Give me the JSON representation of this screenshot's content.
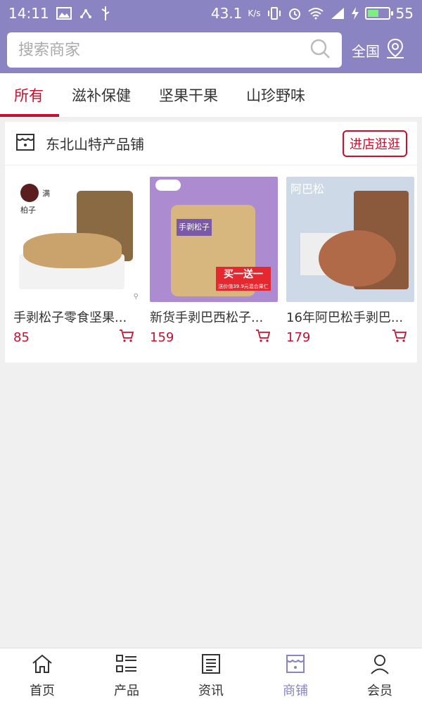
{
  "status_bar": {
    "time": "14:11",
    "speed": "43.1",
    "speed_unit": "K/s",
    "battery": "55",
    "battery_level": 0.55
  },
  "search": {
    "placeholder": "搜索商家",
    "region": "全国"
  },
  "tabs": [
    {
      "label": "所有",
      "active": true
    },
    {
      "label": "滋补保健",
      "active": false
    },
    {
      "label": "坚果干果",
      "active": false
    },
    {
      "label": "山珍野味",
      "active": false
    }
  ],
  "store": {
    "name": "东北山特产品铺",
    "visit_label": "进店逛逛",
    "products": [
      {
        "title": "手剥松子零食坚果...",
        "price": "85",
        "image_label": "满柏子"
      },
      {
        "title": "新货手剥巴西松子...",
        "price": "159",
        "image_label": "手剥松子",
        "promo": "买一送一",
        "promo_sub": "送价值39.9元混合果仁"
      },
      {
        "title": "16年阿巴松手剥巴...",
        "price": "179",
        "image_label": "阿巴松"
      }
    ]
  },
  "bottom_nav": [
    {
      "label": "首页",
      "icon": "home-icon",
      "active": false
    },
    {
      "label": "产品",
      "icon": "list-icon",
      "active": false
    },
    {
      "label": "资讯",
      "icon": "news-icon",
      "active": false
    },
    {
      "label": "商铺",
      "icon": "shop-icon",
      "active": true
    },
    {
      "label": "会员",
      "icon": "user-icon",
      "active": false
    }
  ],
  "colors": {
    "accent": "#8a85c2",
    "primary_red": "#c8102e"
  }
}
